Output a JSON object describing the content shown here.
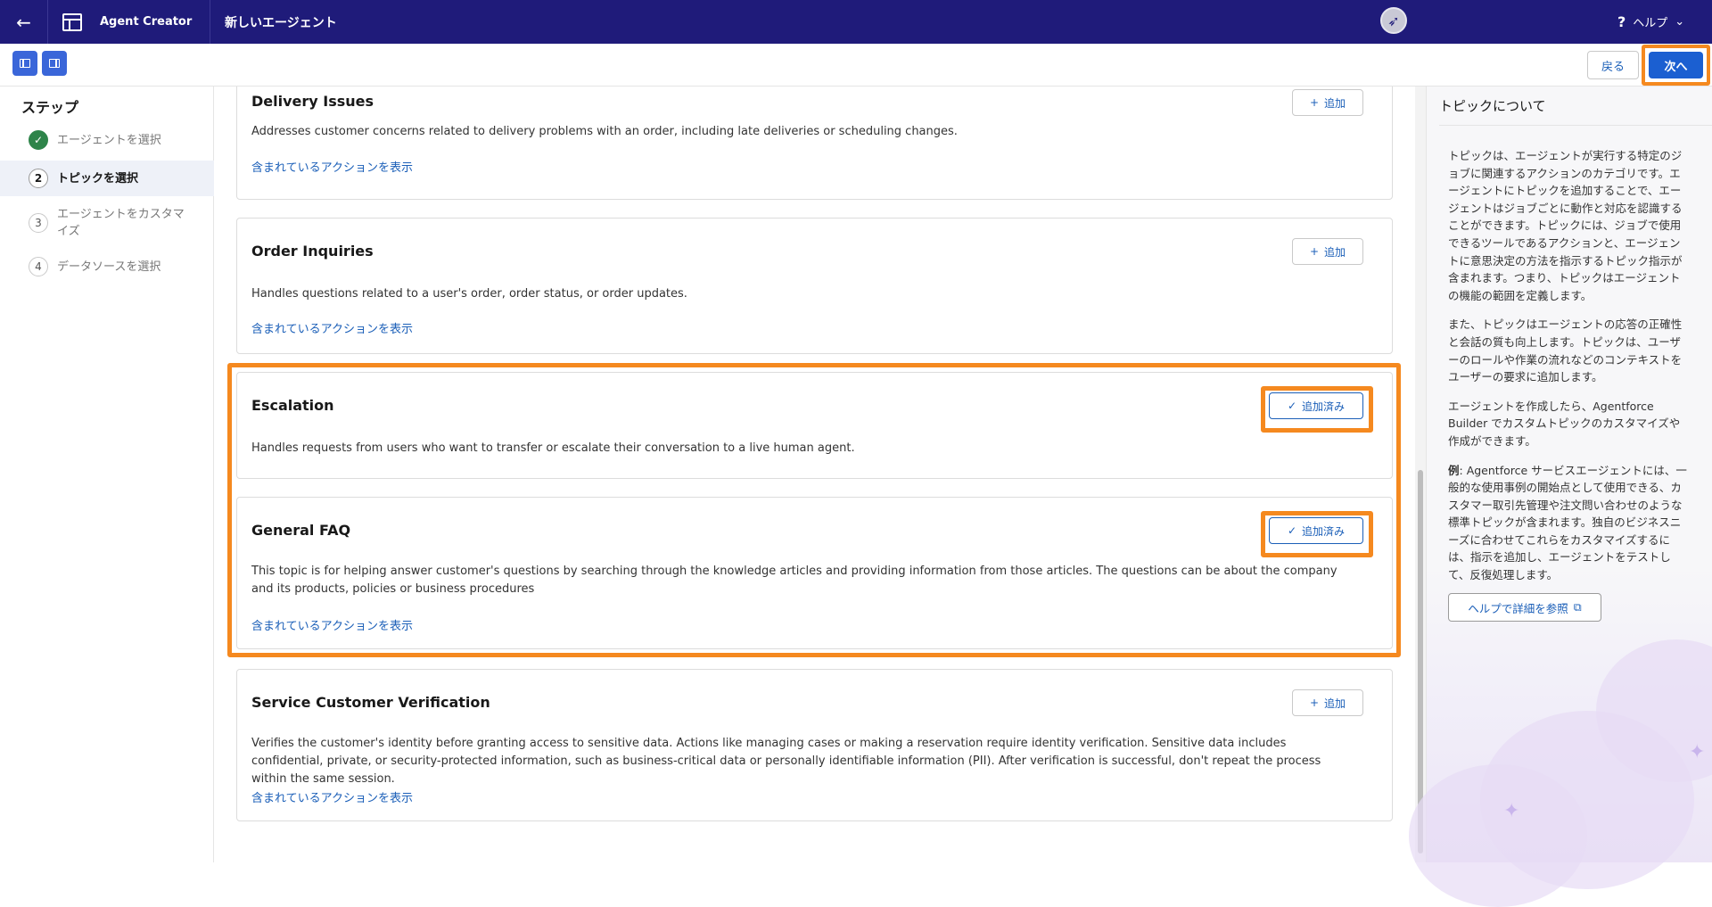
{
  "topbar": {
    "back_icon": "arrow-left-icon",
    "app_name": "Agent Creator",
    "page_name": "新しいエージェント",
    "help_label": "ヘルプ"
  },
  "toolbar": {
    "back_label": "戻る",
    "next_label": "次へ"
  },
  "sidebar": {
    "title": "ステップ",
    "steps": [
      {
        "number": "✓",
        "label": "エージェントを選択",
        "state": "done"
      },
      {
        "number": "2",
        "label": "トピックを選択",
        "state": "active"
      },
      {
        "number": "3",
        "label": "エージェントをカスタマイズ",
        "state": "pending"
      },
      {
        "number": "4",
        "label": "データソースを選択",
        "state": "pending"
      }
    ]
  },
  "topics": [
    {
      "title": "Delivery Issues",
      "description": "Addresses customer concerns related to delivery problems with an order, including late deliveries or scheduling changes.",
      "link": "含まれているアクションを表示",
      "button": "追加",
      "added": false
    },
    {
      "title": "Order Inquiries",
      "description": "Handles questions related to a user's order, order status, or order updates.",
      "link": "含まれているアクションを表示",
      "button": "追加",
      "added": false
    },
    {
      "title": "Escalation",
      "description": "Handles requests from users who want to transfer or escalate their conversation to a live human agent.",
      "link": "",
      "button": "追加済み",
      "added": true
    },
    {
      "title": "General FAQ",
      "description": "This topic is for helping answer customer's questions by searching through the knowledge articles and providing information from those articles. The questions can be about the company and its products, policies or business procedures",
      "link": "含まれているアクションを表示",
      "button": "追加済み",
      "added": true
    },
    {
      "title": "Service Customer Verification",
      "description": "Verifies the customer's identity before granting access to sensitive data. Actions like managing cases or making a reservation require identity verification. Sensitive data includes confidential, private, or security-protected information, such as business-critical data or personally identifiable information (PII). After verification is successful, don't repeat the process within the same session.",
      "link": "含まれているアクションを表示",
      "button": "追加",
      "added": false
    }
  ],
  "right_panel": {
    "title": "トピックについて",
    "para1": "トピックは、エージェントが実行する特定のジョブに関連するアクションのカテゴリです。エージェントにトピックを追加することで、エージェントはジョブごとに動作と対応を認識することができます。トピックには、ジョブで使用できるツールであるアクションと、エージェントに意思決定の方法を指示するトピック指示が含まれます。つまり、トピックはエージェントの機能の範囲を定義します。",
    "para2": "また、トピックはエージェントの応答の正確性と会話の質も向上します。トピックは、ユーザーのロールや作業の流れなどのコンテキストをユーザーの要求に追加します。",
    "para3": "エージェントを作成したら、Agentforce Builder でカスタムトピックのカスタマイズや作成ができます。",
    "para4_bold": "例",
    "para4": ": Agentforce サービスエージェントには、一般的な使用事例の開始点として使用できる、カスタマー取引先管理や注文問い合わせのような標準トピックが含まれます。独自のビジネスニーズに合わせてこれらをカスタマイズするには、指示を追加し、エージェントをテストして、反復処理します。",
    "help_button": "ヘルプで詳細を参照"
  },
  "colors": {
    "topbar_bg": "#1f1b7a",
    "primary": "#1b5fd1",
    "link": "#1b5fb8",
    "highlight": "#f5891f",
    "success": "#2e844a"
  }
}
